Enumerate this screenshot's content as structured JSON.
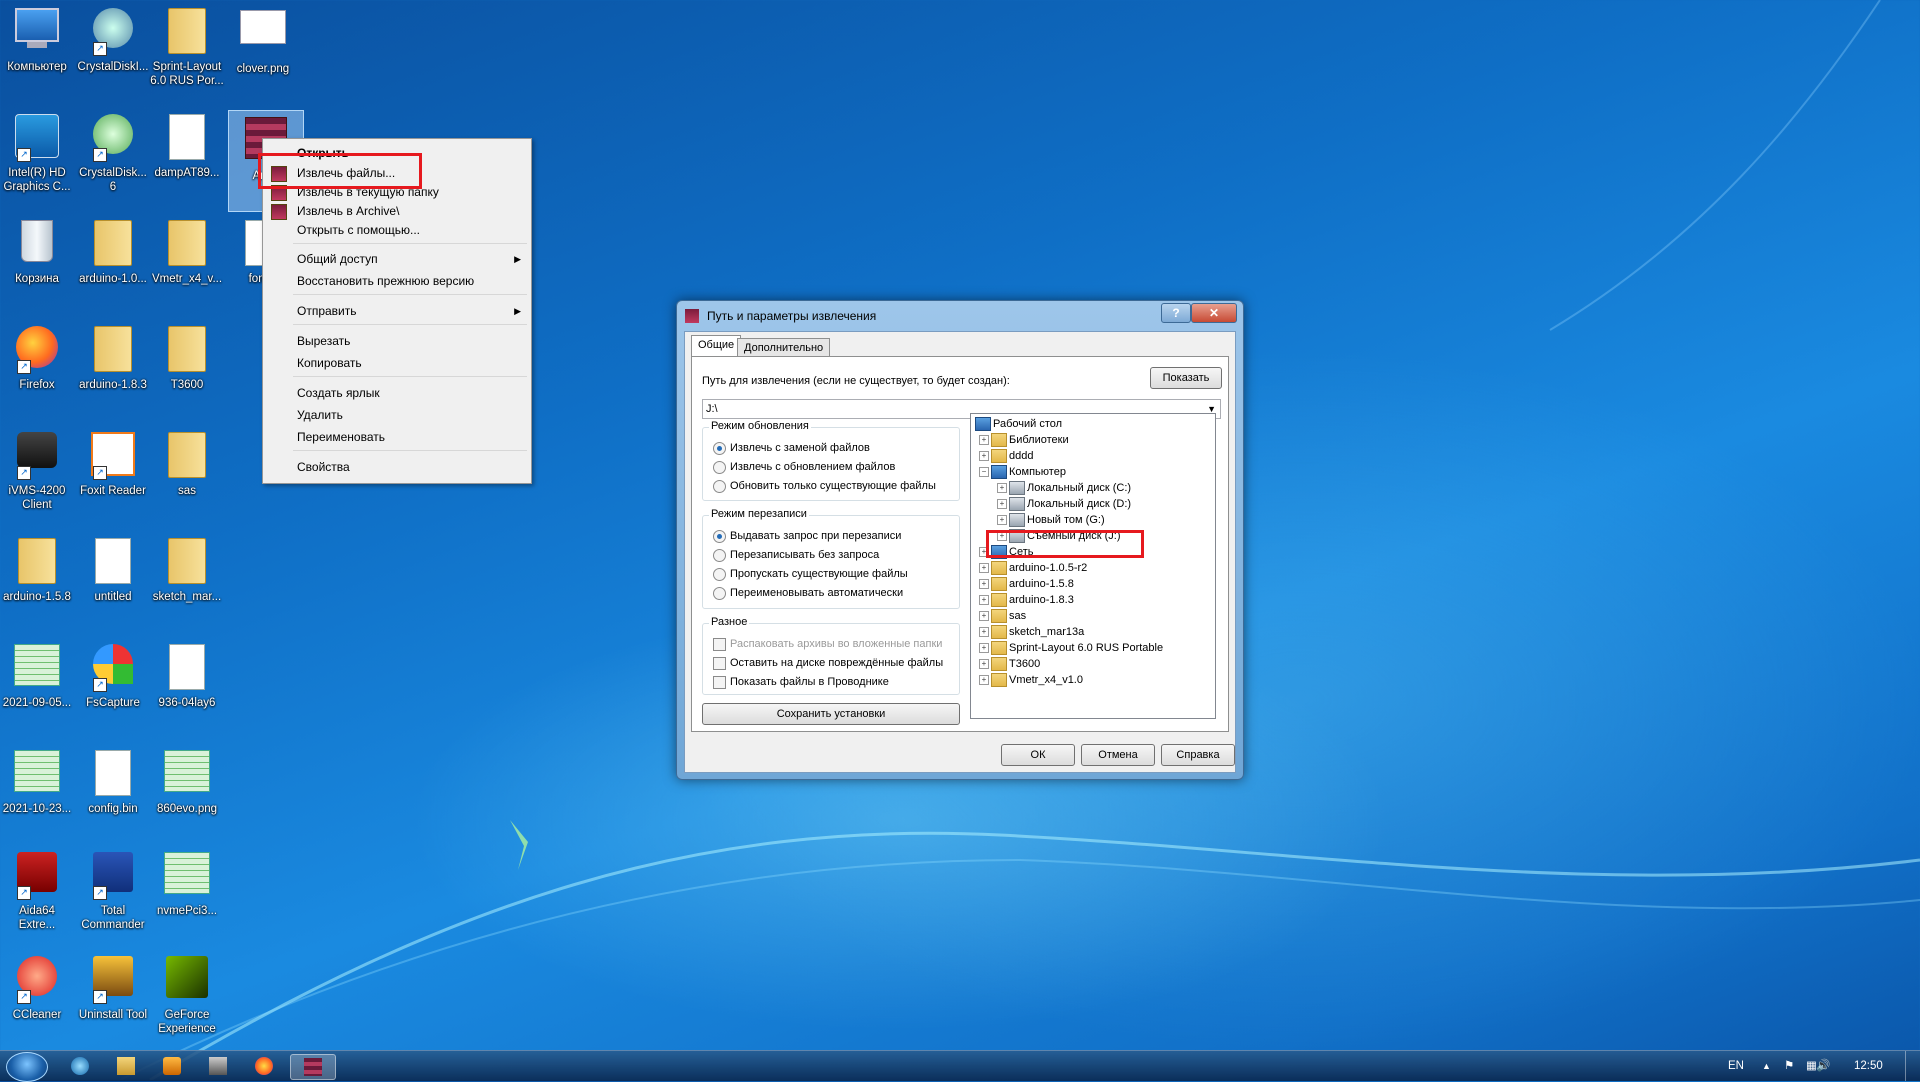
{
  "desktop": {
    "icons": [
      {
        "label": "Компьютер"
      },
      {
        "label": "CrystalDiskI..."
      },
      {
        "label": "Sprint-Layout 6.0 RUS Por..."
      },
      {
        "label": "clover.png"
      },
      {
        "label": "Intel(R) HD Graphics C..."
      },
      {
        "label": "CrystalDisk... 6"
      },
      {
        "label": "dampAT89..."
      },
      {
        "label": "Arc..."
      },
      {
        "label": "Корзина"
      },
      {
        "label": "arduino-1.0..."
      },
      {
        "label": "Vmetr_x4_v..."
      },
      {
        "label": "fom..."
      },
      {
        "label": "Firefox"
      },
      {
        "label": "arduino-1.8.3"
      },
      {
        "label": "T3600"
      },
      {
        "label": "iVMS-4200 Client"
      },
      {
        "label": "Foxit Reader"
      },
      {
        "label": "sas"
      },
      {
        "label": "arduino-1.5.8"
      },
      {
        "label": "untitled"
      },
      {
        "label": "sketch_mar..."
      },
      {
        "label": "2021-09-05..."
      },
      {
        "label": "FsCapture"
      },
      {
        "label": "936-04lay6"
      },
      {
        "label": "2021-10-23..."
      },
      {
        "label": "config.bin"
      },
      {
        "label": "860evo.png"
      },
      {
        "label": "Aida64 Extre..."
      },
      {
        "label": "Total Commander"
      },
      {
        "label": "nvmePci3..."
      },
      {
        "label": "CCleaner"
      },
      {
        "label": "Uninstall Tool"
      },
      {
        "label": "GeForce Experience"
      }
    ]
  },
  "context_menu": {
    "items": [
      {
        "label": "Открыть"
      },
      {
        "label": "Извлечь файлы..."
      },
      {
        "label": "Извлечь в текущую папку"
      },
      {
        "label": "Извлечь в Archive\\"
      },
      {
        "label": "Открыть с помощью..."
      },
      {
        "label": "Общий доступ"
      },
      {
        "label": "Восстановить прежнюю версию"
      },
      {
        "label": "Отправить"
      },
      {
        "label": "Вырезать"
      },
      {
        "label": "Копировать"
      },
      {
        "label": "Создать ярлык"
      },
      {
        "label": "Удалить"
      },
      {
        "label": "Переименовать"
      },
      {
        "label": "Свойства"
      }
    ]
  },
  "dialog": {
    "title": "Путь и параметры извлечения",
    "help_btn": "?",
    "close_btn": "✕",
    "tabs": [
      "Общие",
      "Дополнительно"
    ],
    "path_label": "Путь для извлечения (если не существует, то будет создан):",
    "show_btn": "Показать",
    "path_value": "J:\\",
    "update_mode": {
      "title": "Режим обновления",
      "options": [
        "Извлечь с заменой файлов",
        "Извлечь с обновлением файлов",
        "Обновить только существующие файлы"
      ],
      "selected": 0
    },
    "overwrite_mode": {
      "title": "Режим перезаписи",
      "options": [
        "Выдавать запрос при перезаписи",
        "Перезаписывать без запроса",
        "Пропускать существующие файлы",
        "Переименовывать автоматически"
      ],
      "selected": 0
    },
    "misc": {
      "title": "Разное",
      "options": [
        "Распаковать архивы во вложенные папки",
        "Оставить на диске повреждённые файлы",
        "Показать файлы в Проводнике"
      ]
    },
    "save_btn": "Сохранить установки",
    "tree": [
      {
        "label": "Рабочий стол"
      },
      {
        "label": "Библиотеки"
      },
      {
        "label": "dddd"
      },
      {
        "label": "Компьютер"
      },
      {
        "label": "Локальный диск (C:)"
      },
      {
        "label": "Локальный диск (D:)"
      },
      {
        "label": "Новый том (G:)"
      },
      {
        "label": "Съемный диск (J:)"
      },
      {
        "label": "Сеть"
      },
      {
        "label": "arduino-1.0.5-r2"
      },
      {
        "label": "arduino-1.5.8"
      },
      {
        "label": "arduino-1.8.3"
      },
      {
        "label": "sas"
      },
      {
        "label": "sketch_mar13a"
      },
      {
        "label": "Sprint-Layout 6.0 RUS Portable"
      },
      {
        "label": "T3600"
      },
      {
        "label": "Vmetr_x4_v1.0"
      }
    ],
    "ok_btn": "ОК",
    "cancel_btn": "Отмена",
    "help_text_btn": "Справка"
  },
  "taskbar": {
    "lang": "EN",
    "clock": "12:50"
  }
}
